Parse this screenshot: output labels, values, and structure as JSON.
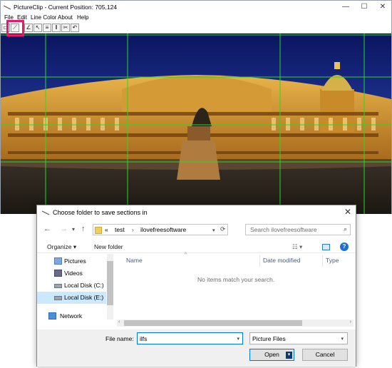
{
  "window": {
    "title": "PictureClip - Current Position: 705,124",
    "controls": {
      "minimize": "—",
      "maximize": "☐",
      "close": "✕"
    }
  },
  "menu": {
    "items": [
      "File",
      "Edit",
      "Line Color",
      "About",
      "Help"
    ]
  },
  "toolbar": {
    "buttons": [
      "open-icon",
      "select-tool-icon",
      "line-tool-icon",
      "cursor-tool-icon",
      "horizontal-lines-icon",
      "vertical-lines-icon",
      "split-tool-icon",
      "undo-icon"
    ],
    "highlighted_index": 1,
    "highlight_color": "#e8196a"
  },
  "canvas": {
    "grid_color": "#22dd22"
  },
  "dialog": {
    "title": "Choose folder to save sections in",
    "close": "✕",
    "nav": {
      "back": "←",
      "forward": "→",
      "up": "↑",
      "refresh": "⟳"
    },
    "address": {
      "prefix": "«",
      "segments": [
        "test",
        "ilovefreesoftware"
      ]
    },
    "search_placeholder": "Search ilovefreesoftware",
    "commands": {
      "organize": "Organize ▾",
      "new_folder": "New folder"
    },
    "nav_pane": [
      {
        "label": "Pictures",
        "icon": "pictures-icon",
        "selected": false
      },
      {
        "label": "Videos",
        "icon": "videos-icon",
        "selected": false
      },
      {
        "label": "Local Disk (C:)",
        "icon": "drive-icon",
        "selected": false
      },
      {
        "label": "Local Disk (E:)",
        "icon": "drive-icon",
        "selected": true
      },
      {
        "label": "Network",
        "icon": "network-icon",
        "selected": false
      }
    ],
    "columns": [
      "Name",
      "Date modified",
      "Type"
    ],
    "empty_message": "No items match your search.",
    "file_name_label": "File name:",
    "file_name_value": "ilfs",
    "file_type": "Picture Files",
    "open_button": "Open",
    "cancel_button": "Cancel"
  }
}
